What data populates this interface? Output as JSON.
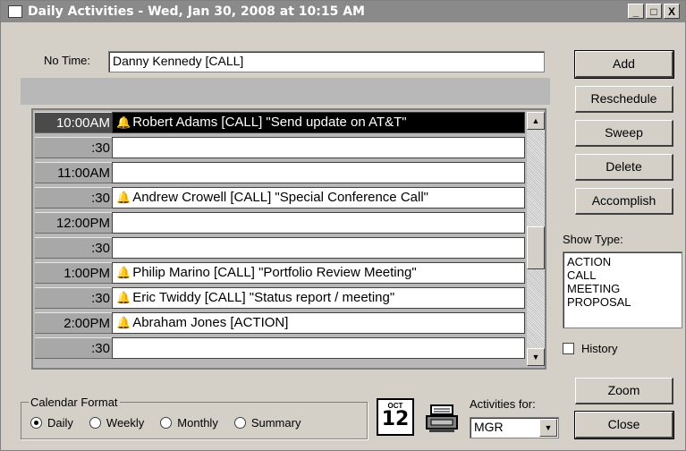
{
  "window": {
    "title": "Daily Activities - Wed, Jan 30, 2008 at 10:15 AM",
    "buttons": {
      "minimize": "_",
      "maximize": "□",
      "close": "X"
    }
  },
  "no_time": {
    "label": "No Time:",
    "value": "Danny Kennedy [CALL]"
  },
  "schedule": {
    "rows": [
      {
        "time": "10:00AM",
        "bell": "bell-icon",
        "text": "Robert Adams [CALL] \"Send update on AT&T\"",
        "selected": true
      },
      {
        "time": ":30",
        "text": ""
      },
      {
        "time": "11:00AM",
        "text": ""
      },
      {
        "time": ":30",
        "bell": "bell-icon",
        "text": "Andrew Crowell [CALL] \"Special Conference Call\""
      },
      {
        "time": "12:00PM",
        "text": ""
      },
      {
        "time": ":30",
        "text": ""
      },
      {
        "time": "1:00PM",
        "bell": "bell-icon",
        "text": "Philip Marino [CALL] \"Portfolio Review Meeting\""
      },
      {
        "time": ":30",
        "bell": "bell-icon",
        "text": "Eric Twiddy [CALL] \"Status report / meeting\""
      },
      {
        "time": "2:00PM",
        "bell": "bell-icon",
        "text": "Abraham Jones [ACTION]"
      },
      {
        "time": ":30",
        "text": ""
      }
    ]
  },
  "actions": {
    "add": "Add",
    "reschedule": "Reschedule",
    "sweep": "Sweep",
    "delete": "Delete",
    "accomplish": "Accomplish",
    "zoom": "Zoom",
    "close": "Close"
  },
  "show_type": {
    "label": "Show Type:",
    "options": [
      "ACTION",
      "CALL",
      "MEETING",
      "PROPOSAL"
    ]
  },
  "history": {
    "label": "History",
    "checked": false
  },
  "calendar_format": {
    "legend": "Calendar Format",
    "options": [
      "Daily",
      "Weekly",
      "Monthly",
      "Summary"
    ],
    "selected": "Daily"
  },
  "calendar_icon": {
    "month": "OCT",
    "day": "12"
  },
  "activities_for": {
    "label": "Activities for:",
    "value": "MGR"
  },
  "colors": {
    "title_bar": "#8a8a8a",
    "face": "#d4d0c8",
    "selected": "#000000"
  }
}
